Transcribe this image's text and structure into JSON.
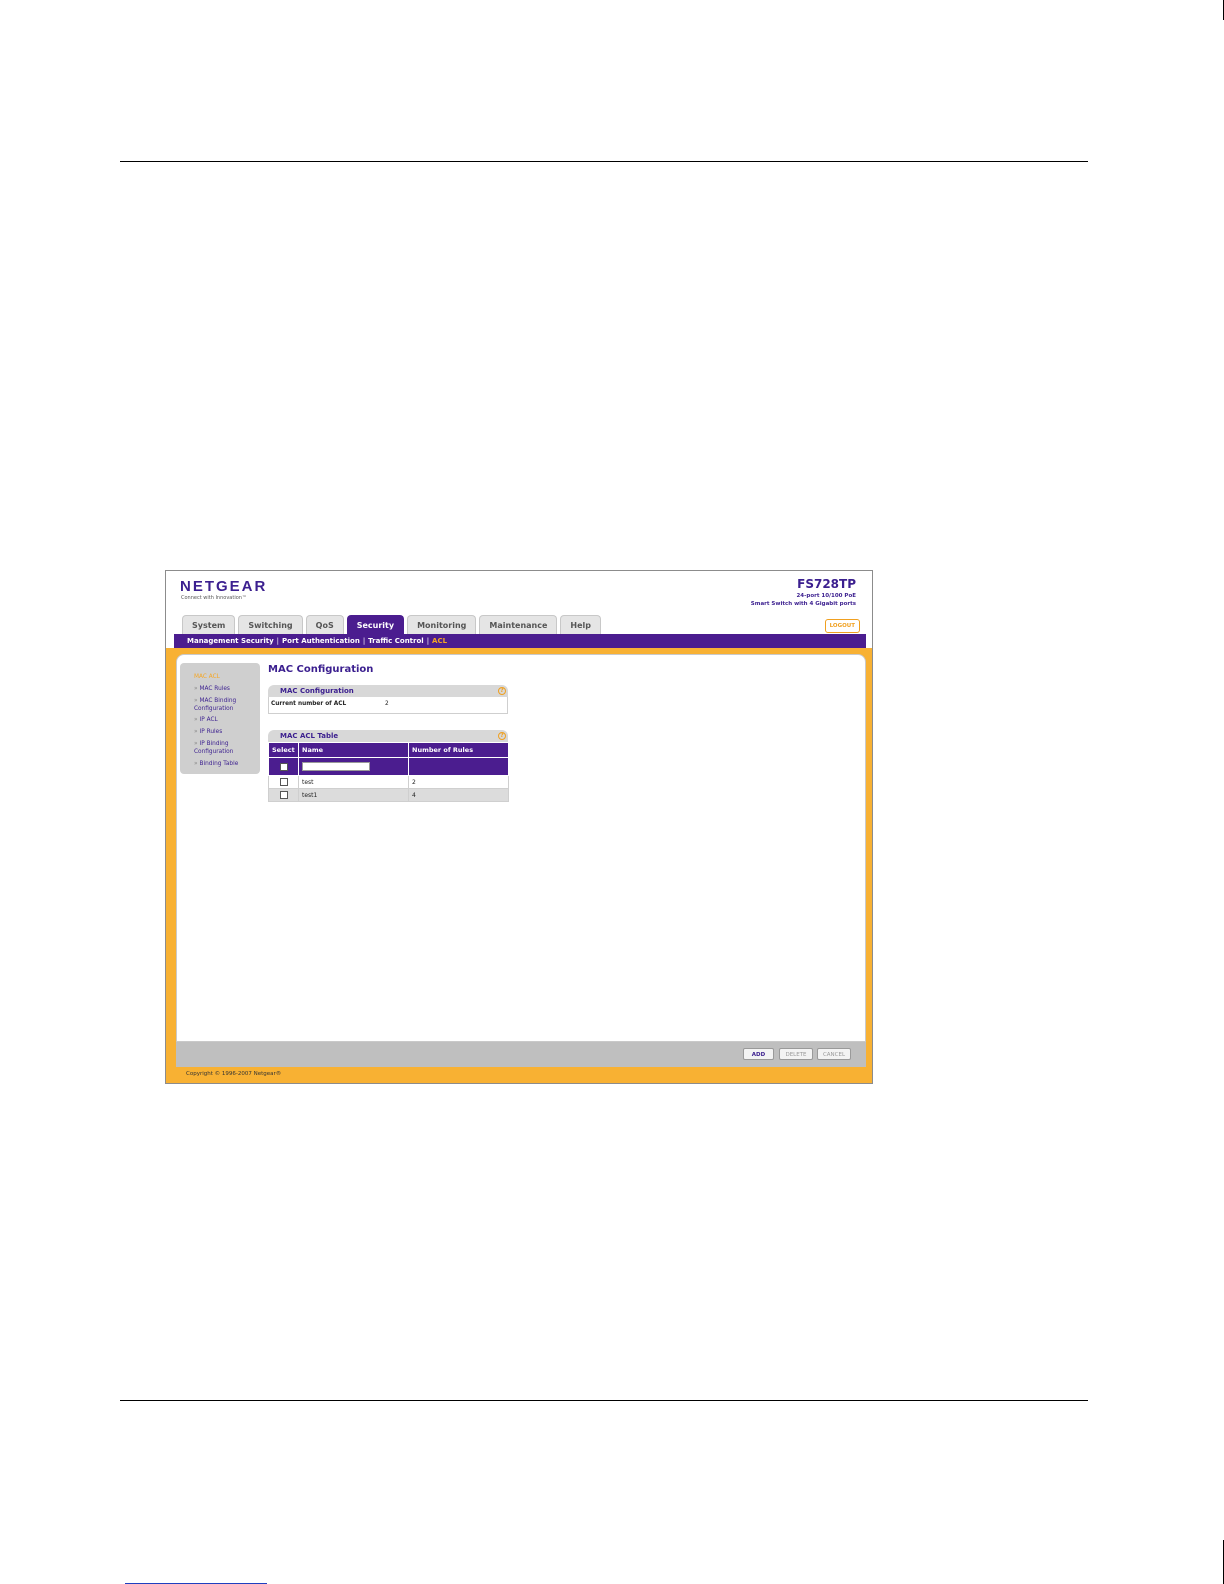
{
  "header": {
    "logo": "NETGEAR",
    "logo_tagline": "Connect with Innovation™",
    "model": "FS728TP",
    "model_desc_line1": "24-port 10/100 PoE",
    "model_desc_line2": "Smart Switch with 4 Gigabit ports",
    "logout_label": "LOGOUT"
  },
  "tabs": [
    "System",
    "Switching",
    "QoS",
    "Security",
    "Monitoring",
    "Maintenance",
    "Help"
  ],
  "active_tab": "Security",
  "subnav": [
    "Management Security",
    "Port Authentication",
    "Traffic Control",
    "ACL"
  ],
  "active_subnav": "ACL",
  "sidebar": [
    "MAC ACL",
    "MAC Rules",
    "MAC Binding Configuration",
    "IP ACL",
    "IP Rules",
    "IP Binding Configuration",
    "Binding Table"
  ],
  "page_title": "MAC Configuration",
  "mac_config": {
    "title": "MAC Configuration",
    "current_acl_label": "Current number of ACL",
    "current_acl_value": "2"
  },
  "acl_table": {
    "title": "MAC ACL Table",
    "headers": [
      "Select",
      "Name",
      "Number of Rules"
    ],
    "rows": [
      {
        "name": "test",
        "rules": "2"
      },
      {
        "name": "test1",
        "rules": "4"
      }
    ]
  },
  "buttons": {
    "add": "ADD",
    "delete": "DELETE",
    "cancel": "CANCEL"
  },
  "copyright": "Copyright © 1996-2007 Netgear®",
  "colors": {
    "brand_purple": "#4b1d8f",
    "accent_orange": "#f8b133"
  }
}
